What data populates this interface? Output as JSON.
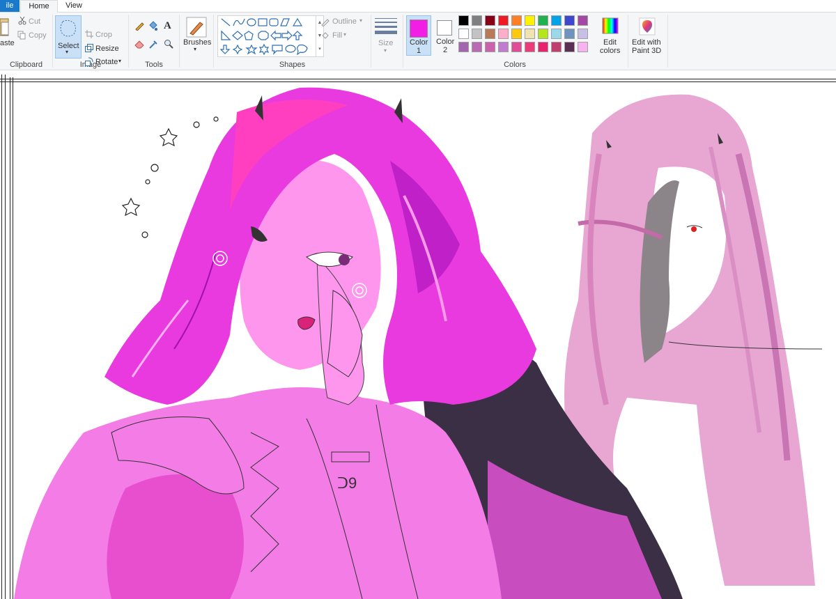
{
  "tabs": {
    "file": "ile",
    "home": "Home",
    "view": "View"
  },
  "clipboard": {
    "paste": "aste",
    "cut": "Cut",
    "copy": "Copy",
    "label": "Clipboard"
  },
  "image": {
    "select": "Select",
    "crop": "Crop",
    "resize": "Resize",
    "rotate": "Rotate",
    "label": "Image"
  },
  "tools": {
    "label": "Tools",
    "text_glyph": "A"
  },
  "brushes": {
    "label": "Brushes"
  },
  "shapes": {
    "outline": "Outline",
    "fill": "Fill",
    "label": "Shapes"
  },
  "size": {
    "label": "Size"
  },
  "colors": {
    "color1": "Color\n1",
    "color1_a": "Color",
    "color1_b": "1",
    "color2_a": "Color",
    "color2_b": "2",
    "edit_a": "Edit",
    "edit_b": "colors",
    "paint3d_a": "Edit with",
    "paint3d_b": "Paint 3D",
    "label": "Colors",
    "color1_value": "#f21ee6",
    "color2_value": "#ffffff",
    "palette": [
      "#000000",
      "#7f7f7f",
      "#880015",
      "#ed1c24",
      "#ff7f27",
      "#fff200",
      "#22b14c",
      "#00a2e8",
      "#3f48cc",
      "#a349a4",
      "#ffffff",
      "#c3c3c3",
      "#b97a57",
      "#ffaec9",
      "#ffc90e",
      "#efe4b0",
      "#b5e61d",
      "#99d9ea",
      "#7092be",
      "#c8bfe7",
      "#a365b0",
      "#b86bb2",
      "#c964ac",
      "#c07dd0",
      "#e04c96",
      "#ec3b7a",
      "#e8256c",
      "#c03f6f",
      "#5b2f52",
      "#f6b3ef"
    ]
  }
}
